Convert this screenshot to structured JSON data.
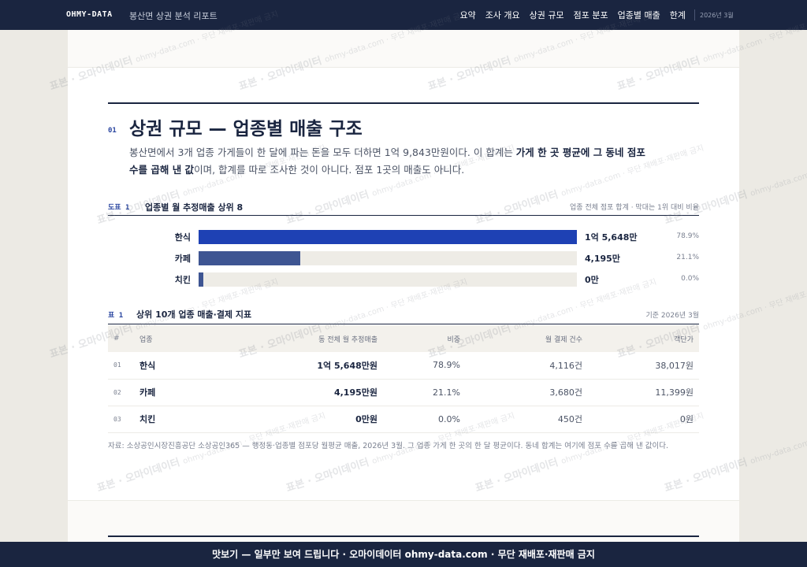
{
  "header": {
    "brand": "OHMY-DATA",
    "report_title": "봉산면 상권 분석 리포트",
    "nav": [
      "요약",
      "조사 개요",
      "상권 규모",
      "점포 분포",
      "업종별 매출",
      "한계"
    ],
    "date": "2026년 3월"
  },
  "section": {
    "number": "01",
    "title": "상권 규모 — 업종별 매출 구조",
    "lead_part1": "봉산면에서 3개 업종 가게들이 한 달에 파는 돈을 모두 더하면 1억 9,843만원이다. 이 합계는 ",
    "lead_bold1": "가게 한 곳 평균에 그 동네 점포 수를 곱해 낸 값",
    "lead_part2": "이며, 합계를 따로 조사한 것이 아니다. 점포 1곳의 매출도 아니다."
  },
  "figure": {
    "label": "도표 1",
    "title": "업종별 월 추정매출 상위 8",
    "note": "업종 전체 점포 합계 · 막대는 1위 대비 비율"
  },
  "chart_data": {
    "type": "bar",
    "orientation": "horizontal",
    "categories": [
      "한식",
      "카페",
      "치킨"
    ],
    "values": [
      15648,
      4195,
      0
    ],
    "value_labels": [
      "1억 5,648만",
      "4,195만",
      "0만"
    ],
    "shares": [
      "78.9%",
      "21.1%",
      "0.0%"
    ],
    "colors": [
      "#1e41b4",
      "#3e5592",
      "#3e5592"
    ],
    "title": "업종별 월 추정매출 상위 8",
    "xlabel": "",
    "ylabel": ""
  },
  "table": {
    "label": "표 1",
    "title": "상위 10개 업종 매출·결제 지표",
    "note": "기준 2026년 3월",
    "columns": [
      "#",
      "업종",
      "동 전체 월 추정매출",
      "비중",
      "월 결제 건수",
      "객단가"
    ],
    "rows": [
      [
        "01",
        "한식",
        "1억 5,648만원",
        "78.9%",
        "4,116건",
        "38,017원"
      ],
      [
        "02",
        "카페",
        "4,195만원",
        "21.1%",
        "3,680건",
        "11,399원"
      ],
      [
        "03",
        "치킨",
        "0만원",
        "0.0%",
        "450건",
        "0원"
      ]
    ]
  },
  "source": "자료: 소상공인시장진흥공단 소상공인365 — 행정동·업종별 점포당 월평균 매출, 2026년 3월. 그 업종 가게 한 곳의 한 달 평균이다. 동네 합계는 여기에 점포 수를 곱해 낸 값이다.",
  "watermark": {
    "main": "표본 · 오마이데이터",
    "small": "ohmy-data.com · 무단 재배포·재판매 금지"
  },
  "footer": {
    "text": "맛보기 — 일부만 보여 드립니다 · 오마이데이터 ohmy-data.com · 무단 재배포·재판매 금지"
  }
}
